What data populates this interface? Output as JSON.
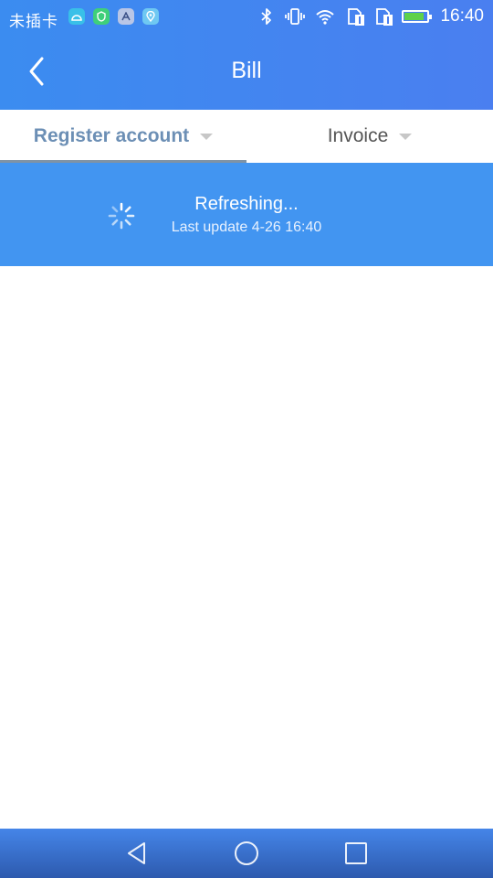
{
  "status_bar": {
    "carrier": "未插卡",
    "notification_icons": [
      "android-icon",
      "shield-icon",
      "translate-icon",
      "location-pin-icon"
    ],
    "right_icons": [
      "bluetooth-icon",
      "vibrate-icon",
      "wifi-icon",
      "sim1-icon",
      "sim2-icon",
      "battery-charging-icon"
    ],
    "time": "16:40",
    "battery_level": 0.85
  },
  "app_bar": {
    "title": "Bill",
    "back_icon": "chevron-left-icon"
  },
  "tabs": [
    {
      "label": "Register account",
      "active": true
    },
    {
      "label": "Invoice",
      "active": false
    }
  ],
  "refresh": {
    "title": "Refreshing...",
    "subtitle": "Last update 4-26 16:40"
  },
  "nav_bar": {
    "buttons": [
      "back-triangle-icon",
      "home-circle-icon",
      "recents-square-icon"
    ]
  },
  "colors": {
    "header": "#3b8cf0",
    "refresh_bg": "#4295f1",
    "active_tab": "#6c8fb5",
    "indicator": "#7f93a6"
  }
}
